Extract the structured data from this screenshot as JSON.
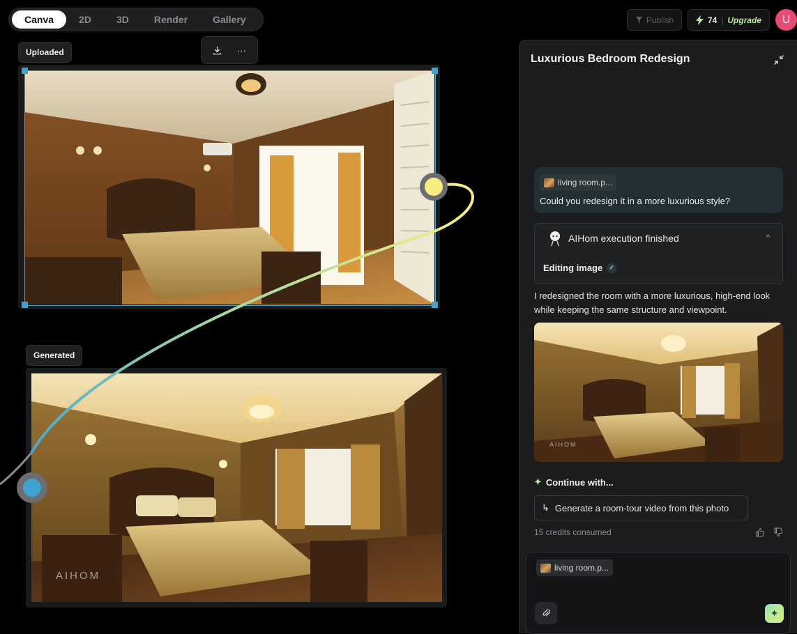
{
  "nav": {
    "tabs": [
      {
        "label": "Canva",
        "active": true
      },
      {
        "label": "2D",
        "active": false
      },
      {
        "label": "3D",
        "active": false
      },
      {
        "label": "Render",
        "active": false
      },
      {
        "label": "Gallery",
        "active": false
      }
    ]
  },
  "topbar": {
    "publish_label": "Publish",
    "credits_count": "74",
    "credits_separator": "|",
    "upgrade_label": "Upgrade",
    "avatar_initial": "U",
    "avatar_color": "#e84a76"
  },
  "canvas": {
    "uploaded_label": "Uploaded",
    "generated_label": "Generated",
    "toolbar": {
      "download_icon": "download-icon",
      "more_label": "···"
    },
    "connector": {
      "start_color": "#f8ee7f",
      "end_color": "#3fa3d2"
    }
  },
  "panel": {
    "title": "Luxurious Bedroom Redesign",
    "user_message": {
      "attachment": "living room.p...",
      "text": "Could you redesign it in a more luxurious style?"
    },
    "execution": {
      "title": "AIHom execution finished",
      "chevron": "^",
      "step": "Editing image",
      "step_check": "✓"
    },
    "reply": "I redesigned the room with a more luxurious, high-end look while keeping the same structure and viewpoint.",
    "watermark": "AIHOM",
    "continue_label": "Continue with...",
    "suggestion": "Generate a room-tour video from this photo",
    "suggestion_arrow": "↳",
    "credits_consumed": "15 credits consumed",
    "thumb_up": "👍",
    "thumb_down": "👎"
  },
  "composer": {
    "attachment": "living room.p..."
  }
}
